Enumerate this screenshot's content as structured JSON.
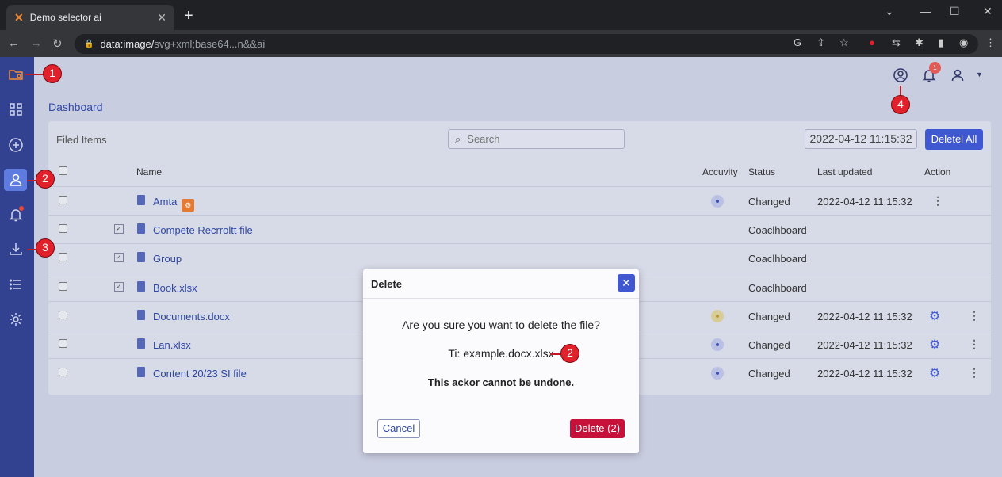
{
  "browser": {
    "tab_title": "Demo selector ai",
    "url_main": "data:image/",
    "url_rest": "svg+xml;base64...n&&ai"
  },
  "app": {
    "breadcrumb": "Dashboard",
    "notification_count": "1",
    "sidebar_icons": [
      "folder-gear-icon",
      "grid-icon",
      "plus-circle-icon",
      "user-icon",
      "bell-icon",
      "download-icon",
      "list-icon",
      "gear-icon"
    ]
  },
  "card": {
    "title": "Filed Items",
    "search_placeholder": "Search",
    "date_value": "2022-04-12 11:15:32",
    "delete_all_label": "Deletel All",
    "columns": {
      "name": "Name",
      "activity": "Accuvity",
      "status": "Status",
      "updated": "Last updated",
      "action": "Action"
    },
    "rows": [
      {
        "name": "Amta",
        "status": "Changed",
        "updated": "2022-04-12 11:15:32"
      },
      {
        "name": "Compete Recrroltt file",
        "status": "Coaclhboard",
        "updated": ""
      },
      {
        "name": "Group",
        "status": "Coaclhboard",
        "updated": ""
      },
      {
        "name": "Book.xlsx",
        "status": "Coaclhboard",
        "updated": ""
      },
      {
        "name": "Documents.docx",
        "status": "Changed",
        "updated": "2022-04-12 11:15:32"
      },
      {
        "name": "Lan.xlsx",
        "status": "Changed",
        "updated": "2022-04-12 11:15:32"
      },
      {
        "name": "Content 20/23 SI file",
        "status": "Changed",
        "updated": "2022-04-12 11:15:32"
      }
    ]
  },
  "modal": {
    "title": "Delete",
    "question": "Are you sure you want to delete the file?",
    "file_line": "Ti: example.docx.xlsx",
    "warning": "This ackor cannot be undone.",
    "cancel_label": "Cancel",
    "delete_label": "Delete (2)"
  },
  "markers": [
    "1",
    "2",
    "3",
    "4",
    "2"
  ],
  "colors": {
    "sidebar": "#334290",
    "accent": "#3f57d1",
    "danger": "#c6123a",
    "marker": "#e0212b"
  }
}
